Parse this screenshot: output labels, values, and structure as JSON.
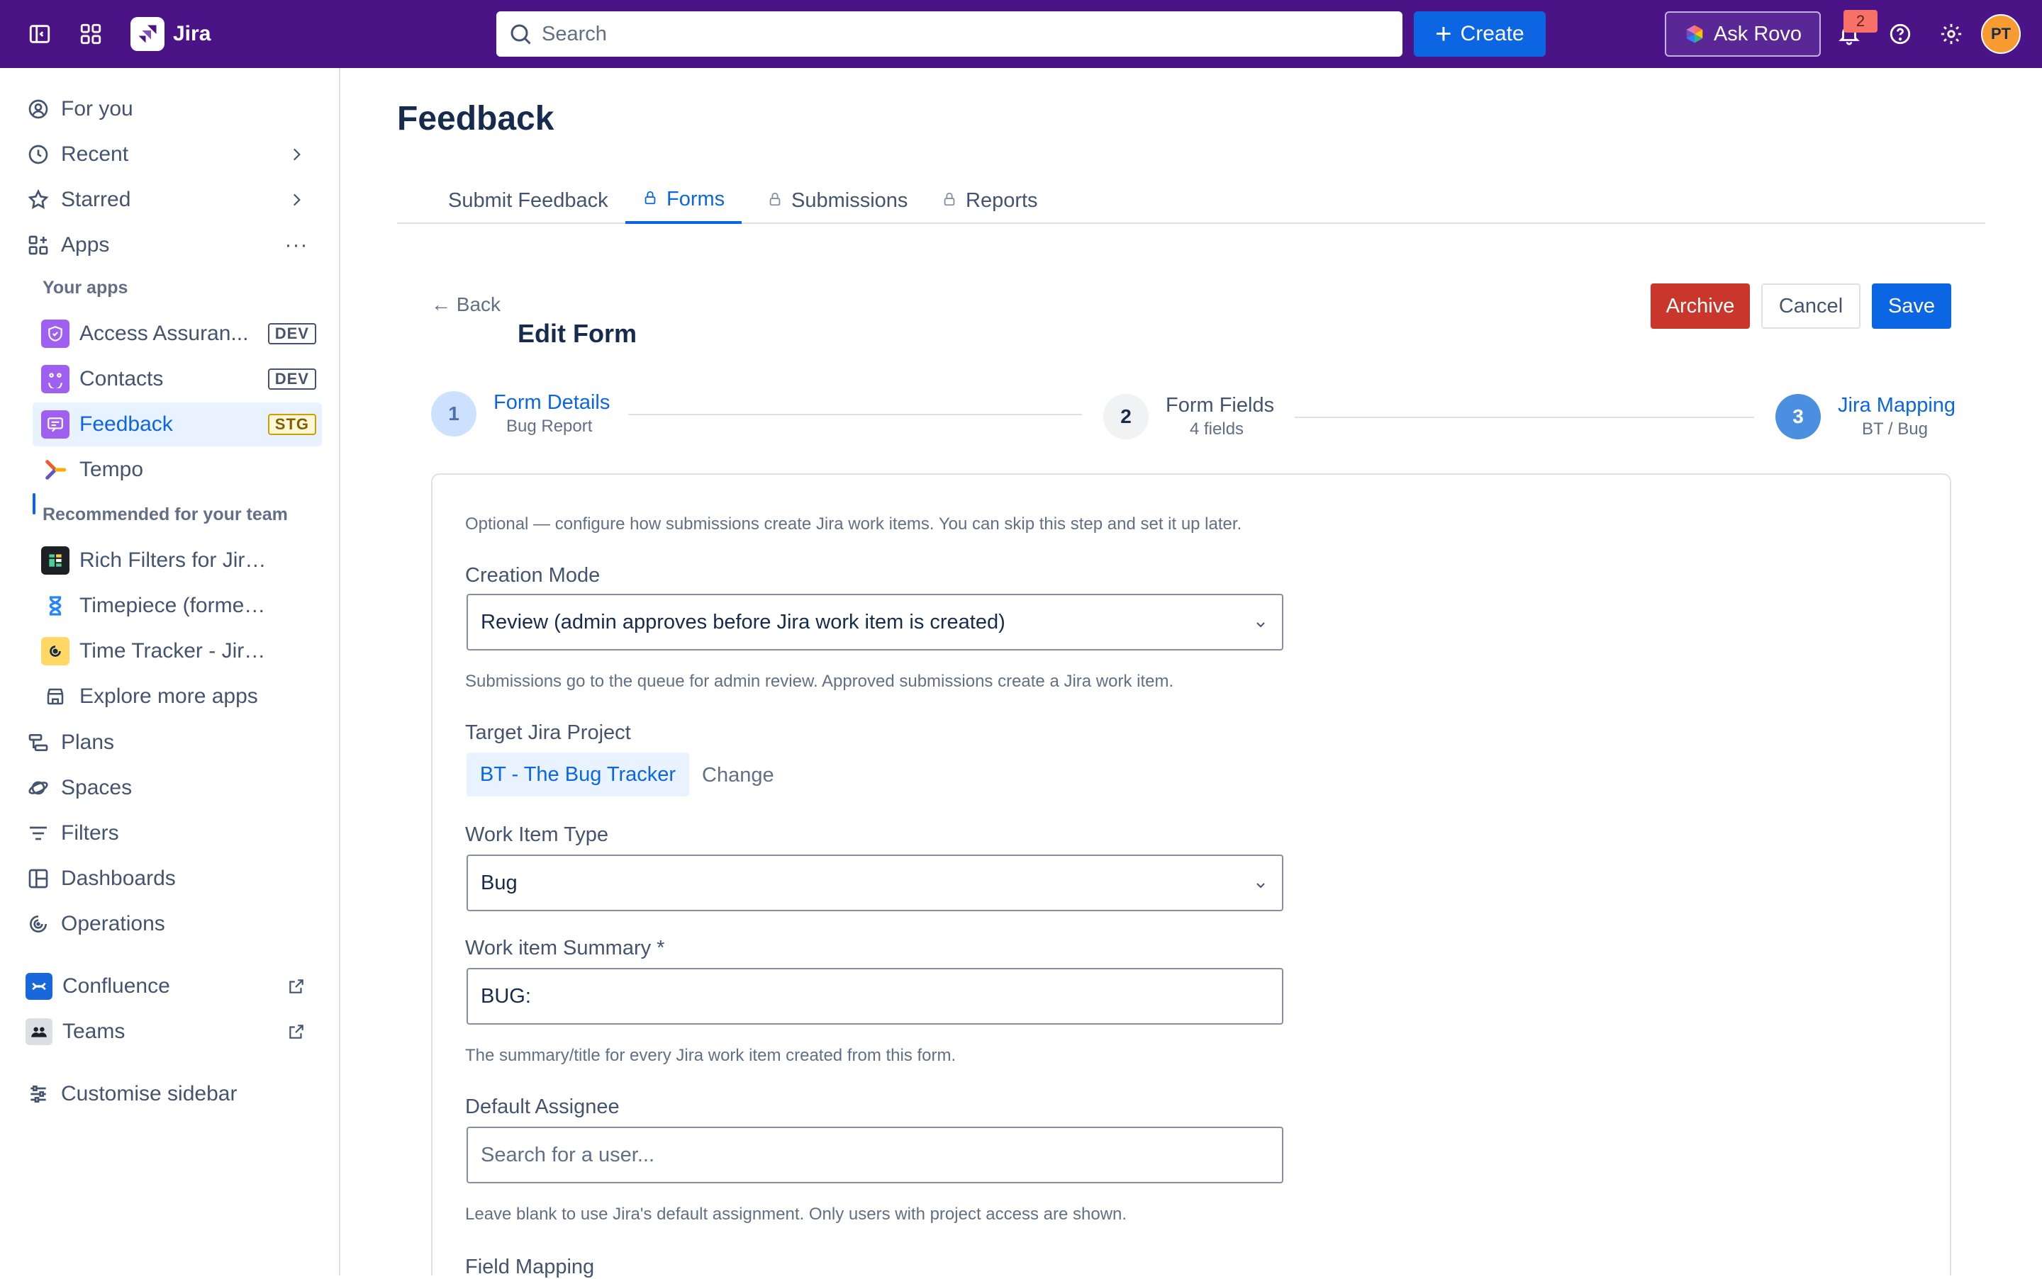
{
  "topbar": {
    "app_name": "Jira",
    "search_placeholder": "Search",
    "create_label": "Create",
    "rovo_label": "Ask Rovo",
    "notifications_count": "2",
    "avatar_initials": "PT",
    "colors": {
      "bg": "#4b1486",
      "create": "#0c66e4"
    }
  },
  "sidebar": {
    "top_items": [
      {
        "label": "For you",
        "icon": "user-circle-icon"
      },
      {
        "label": "Recent",
        "icon": "clock-icon"
      },
      {
        "label": "Starred",
        "icon": "star-icon"
      },
      {
        "label": "Apps",
        "icon": "apps-icon"
      }
    ],
    "your_apps_heading": "Your apps",
    "your_apps": [
      {
        "label": "Access Assuran...",
        "tag": "DEV",
        "color": "#9f5ff0"
      },
      {
        "label": "Contacts",
        "tag": "DEV",
        "color": "#9f5ff0"
      },
      {
        "label": "Feedback",
        "tag": "STG",
        "color": "#9f5ff0"
      },
      {
        "label": "Tempo",
        "tag": "",
        "color": "#f15b2a"
      }
    ],
    "recommended_heading": "Recommended for your team",
    "recommended": [
      {
        "label": "Rich Filters for Jira D...",
        "color": "#1d2125"
      },
      {
        "label": "Timepiece (formerly ...",
        "color": "#2684ff"
      },
      {
        "label": "Time Tracker - Jira Ti...",
        "color": "#ffc400"
      },
      {
        "label": "Explore more apps",
        "color": "#44546f"
      }
    ],
    "bottom_items": [
      {
        "label": "Plans",
        "icon": "plans-icon"
      },
      {
        "label": "Spaces",
        "icon": "spaces-icon"
      },
      {
        "label": "Filters",
        "icon": "filter-icon"
      },
      {
        "label": "Dashboards",
        "icon": "dashboard-icon"
      },
      {
        "label": "Operations",
        "icon": "operations-icon"
      }
    ],
    "external_items": [
      {
        "label": "Confluence"
      },
      {
        "label": "Teams"
      }
    ],
    "customise_label": "Customise sidebar"
  },
  "main": {
    "page_title": "Feedback",
    "tabs": [
      {
        "label": "Submit Feedback",
        "locked": false
      },
      {
        "label": "Forms",
        "locked": true
      },
      {
        "label": "Submissions",
        "locked": true
      },
      {
        "label": "Reports",
        "locked": true
      }
    ],
    "back_label": "← Back",
    "edit_title": "Edit Form",
    "buttons": {
      "archive": "Archive",
      "cancel": "Cancel",
      "save": "Save"
    },
    "steps": [
      {
        "num": "1",
        "label": "Form Details",
        "sub": "Bug Report"
      },
      {
        "num": "2",
        "label": "Form Fields",
        "sub": "4 fields"
      },
      {
        "num": "3",
        "label": "Jira Mapping",
        "sub": "BT / Bug"
      }
    ],
    "form": {
      "intro": "Optional — configure how submissions create Jira work items. You can skip this step and set it up later.",
      "creation_mode_label": "Creation Mode",
      "creation_mode_value": "Review (admin approves before Jira work item is created)",
      "creation_mode_help": "Submissions go to the queue for admin review. Approved submissions create a Jira work item.",
      "target_project_label": "Target Jira Project",
      "target_project_value": "BT - The Bug Tracker",
      "change_label": "Change",
      "work_item_type_label": "Work Item Type",
      "work_item_type_value": "Bug",
      "summary_label": "Work item Summary *",
      "summary_value": "BUG:",
      "summary_help": "The summary/title for every Jira work item created from this form.",
      "assignee_label": "Default Assignee",
      "assignee_placeholder": "Search for a user...",
      "assignee_help": "Leave blank to use Jira's default assignment. Only users with project access are shown.",
      "field_mapping_label": "Field Mapping"
    }
  }
}
